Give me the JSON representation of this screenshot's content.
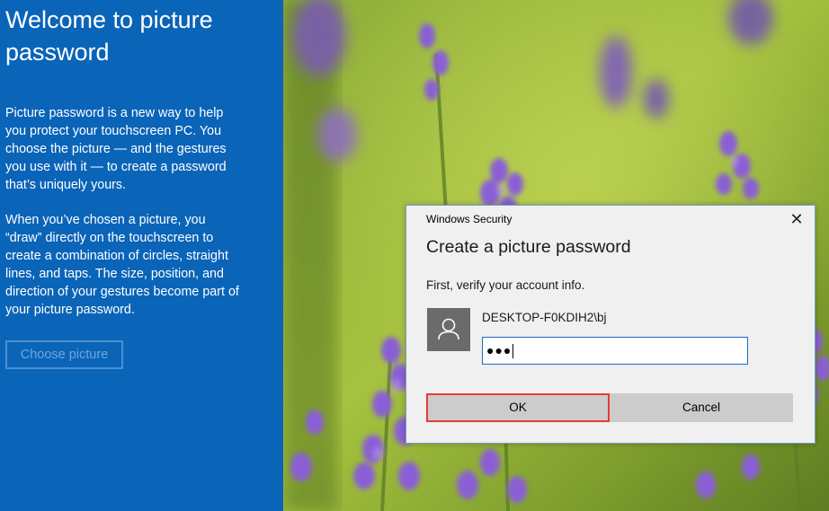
{
  "left_panel": {
    "title": "Welcome to picture password",
    "paragraph_1": "Picture password is a new way to help you protect your touchscreen PC. You choose the picture — and the gestures you use with it — to create a password that’s uniquely yours.",
    "paragraph_2": "When you’ve chosen a picture, you “draw” directly on the touchscreen to create a combination of circles, straight lines, and taps. The size, position, and direction of your gestures become part of your picture password.",
    "choose_button_label": "Choose picture"
  },
  "background_image": {
    "description_icon": "lavender-photo"
  },
  "dialog": {
    "caption": "Windows Security",
    "close_glyph": "✕",
    "title": "Create a picture password",
    "subtitle": "First, verify your account info.",
    "username": "DESKTOP-F0KDIH2\\bj",
    "password_mask": "●●●",
    "ok_label": "OK",
    "cancel_label": "Cancel"
  },
  "colors": {
    "panel_blue": "#0a64b8",
    "highlight_red": "#e83a3a",
    "field_border_blue": "#1b6cc6"
  }
}
